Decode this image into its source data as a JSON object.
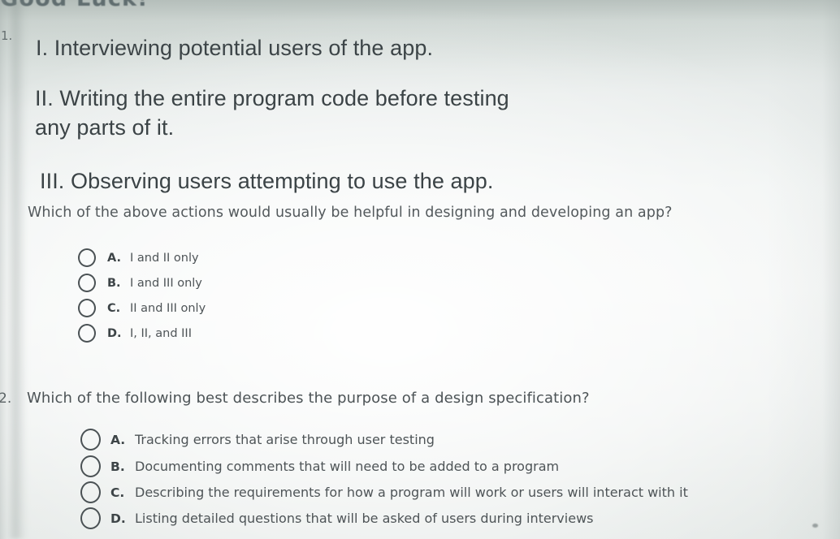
{
  "page": {
    "cutoff_header": "Good Luck!",
    "ink_color": "#3b4346",
    "paper_color": "#f1f4f3"
  },
  "questions": [
    {
      "number": "1.",
      "statements": [
        "I. Interviewing potential users of the app.",
        "II. Writing the entire program code before testing\nany parts of it.",
        "III. Observing users attempting to use the app."
      ],
      "prompt": "Which of the above actions would usually be helpful in designing and developing an app?",
      "options": [
        {
          "letter": "A.",
          "text": "I and II only"
        },
        {
          "letter": "B.",
          "text": "I and III only"
        },
        {
          "letter": "C.",
          "text": "II and III only"
        },
        {
          "letter": "D.",
          "text": "I, II, and III"
        }
      ]
    },
    {
      "number": "2.",
      "prompt": "Which of the following best describes the purpose of a design specification?",
      "options": [
        {
          "letter": "A.",
          "text": "Tracking errors that arise through user testing"
        },
        {
          "letter": "B.",
          "text": "Documenting comments that will need to be added to a program"
        },
        {
          "letter": "C.",
          "text": "Describing the requirements for how a program will work or users will interact with it"
        },
        {
          "letter": "D.",
          "text": "Listing detailed questions that will be asked of users during interviews"
        }
      ]
    }
  ]
}
